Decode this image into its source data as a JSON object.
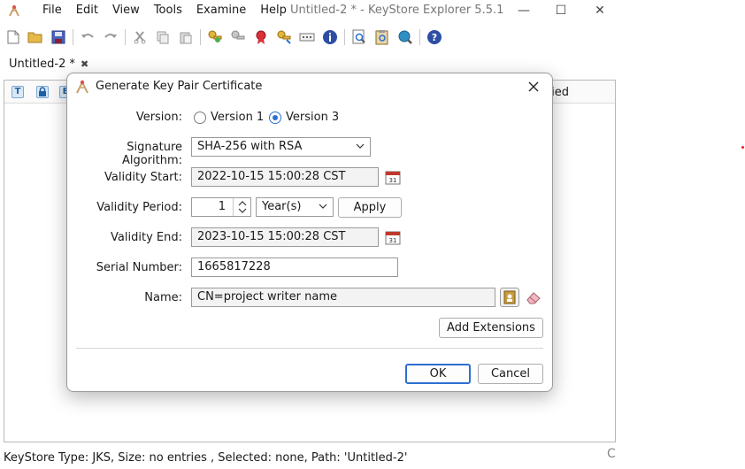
{
  "menu": {
    "items": [
      "File",
      "Edit",
      "View",
      "Tools",
      "Examine",
      "Help"
    ]
  },
  "window": {
    "title": "Untitled-2 * - KeyStore Explorer 5.5.1"
  },
  "window_controls": {
    "minimize": "—",
    "maximize": "☐",
    "close": "✕"
  },
  "tabs": [
    {
      "label": "Untitled-2 *",
      "close": "✖"
    }
  ],
  "table": {
    "header_modified": "ified",
    "header_icons": [
      "T",
      "lock",
      "E"
    ]
  },
  "status_bar": {
    "text": "KeyStore Type: JKS, Size: no entries , Selected: none, Path: 'Untitled-2'",
    "edge_char": "C"
  },
  "dialog": {
    "title": "Generate Key Pair Certificate",
    "version": {
      "label": "Version:",
      "options": [
        "Version 1",
        "Version 3"
      ],
      "selected": "Version 3"
    },
    "signature_algorithm": {
      "label": "Signature Algorithm:",
      "value": "SHA-256 with RSA"
    },
    "validity_start": {
      "label": "Validity Start:",
      "value": "2022-10-15 15:00:28 CST"
    },
    "validity_period": {
      "label": "Validity Period:",
      "amount": "1",
      "unit": "Year(s)",
      "apply_label": "Apply"
    },
    "validity_end": {
      "label": "Validity End:",
      "value": "2023-10-15 15:00:28 CST"
    },
    "serial_number": {
      "label": "Serial Number:",
      "value": "1665817228"
    },
    "name": {
      "label": "Name:",
      "value": "CN=project writer name"
    },
    "add_extensions_label": "Add Extensions",
    "ok_label": "OK",
    "cancel_label": "Cancel"
  },
  "colors": {
    "accent": "#2c6fd1",
    "dialog_border": "#9a9a9a"
  }
}
